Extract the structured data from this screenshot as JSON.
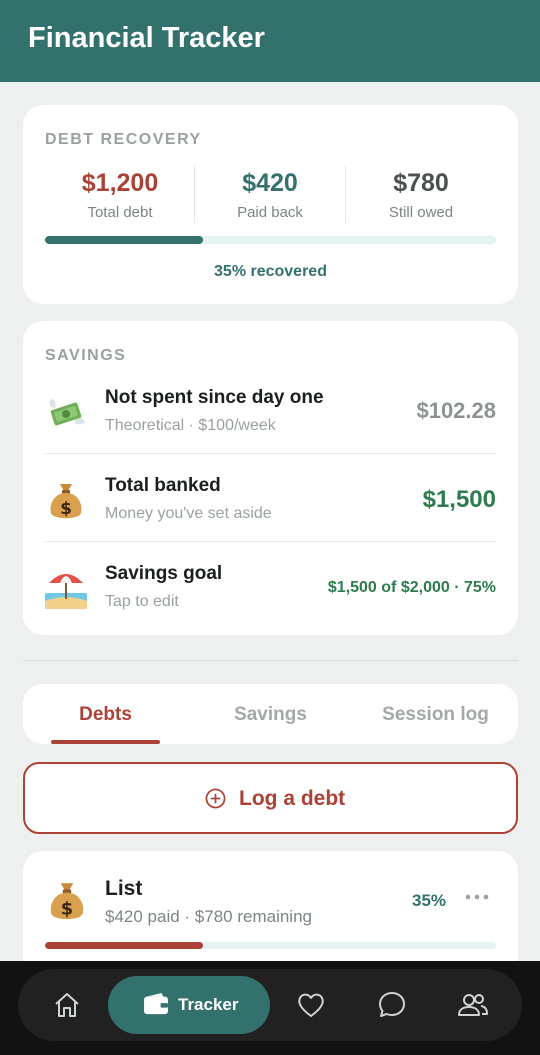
{
  "app": {
    "title": "Financial Tracker"
  },
  "debt_recovery": {
    "title": "DEBT RECOVERY",
    "stats": [
      {
        "value": "$1,200",
        "label": "Total debt",
        "color": "#ab4237"
      },
      {
        "value": "$420",
        "label": "Paid back",
        "color": "#33716d"
      },
      {
        "value": "$780",
        "label": "Still owed",
        "color": "#4a4f4f"
      }
    ],
    "progress": 0.35,
    "progress_text": "35% recovered"
  },
  "savings": {
    "title": "SAVINGS",
    "rows": [
      {
        "icon": "money-with-wings-icon",
        "title": "Not spent since day one",
        "subtitle": "Theoretical · $100/week",
        "amount": "$102.28",
        "amount_color": "#8d9392"
      },
      {
        "icon": "money-bag-icon",
        "title": "Total banked",
        "subtitle": "Money you've set aside",
        "amount": "$1,500",
        "amount_color": "#2e7b4f"
      },
      {
        "icon": "beach-umbrella-icon",
        "title": "Savings goal",
        "subtitle": "Tap to edit",
        "amount": "$1,500 of $2,000 · 75%",
        "amount_color": "#2e7b4f"
      }
    ]
  },
  "tabs": [
    {
      "label": "Debts",
      "active": true
    },
    {
      "label": "Savings",
      "active": false
    },
    {
      "label": "Session log",
      "active": false
    }
  ],
  "log_button": {
    "label": "Log a debt",
    "icon": "plus-circle-icon"
  },
  "debt_item": {
    "icon": "money-bag-icon",
    "title": "List",
    "subtitle": "$420 paid · $780 remaining",
    "percent": "35%",
    "progress": 0.35
  },
  "nav": {
    "active_label": "Tracker",
    "items": [
      "home-icon",
      "wallet-icon",
      "heart-icon",
      "chat-icon",
      "people-icon"
    ]
  },
  "colors": {
    "accent": "#33716d",
    "danger": "#ab4237",
    "success": "#2e7b4f"
  }
}
